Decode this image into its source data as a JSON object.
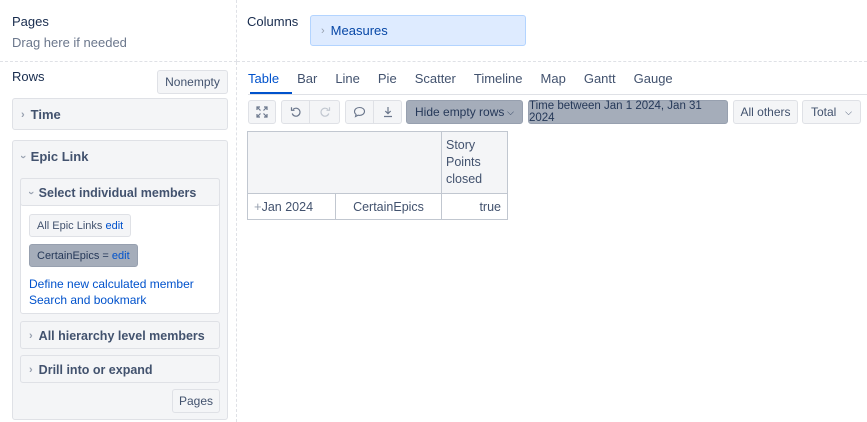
{
  "pages": {
    "title": "Pages",
    "hint": "Drag here if needed"
  },
  "columns": {
    "title": "Columns",
    "measures_label": "Measures"
  },
  "rows": {
    "title": "Rows",
    "nonempty_label": "Nonempty",
    "time_label": "Time",
    "epic_link_label": "Epic Link",
    "select_members_label": "Select individual members",
    "members": [
      {
        "label": "All Epic Links",
        "edit": "edit"
      },
      {
        "label": "CertainEpics =",
        "edit": "edit"
      }
    ],
    "define_calculated": "Define new calculated member",
    "search_bookmark": "Search and bookmark",
    "hierarchy_label": "All hierarchy level members",
    "drill_label": "Drill into or expand",
    "pages_button": "Pages"
  },
  "tabs": [
    "Table",
    "Bar",
    "Line",
    "Pie",
    "Scatter",
    "Timeline",
    "Map",
    "Gantt",
    "Gauge"
  ],
  "toolbar": {
    "hide_empty_rows": "Hide empty rows",
    "time_filter": "Time between Jan 1 2024, Jan 31 2024",
    "all_others": "All others",
    "total": "Total"
  },
  "table": {
    "measure_header": [
      "Story",
      "Points",
      "closed"
    ],
    "row": {
      "time": "Jan 2024",
      "epic": "CertainEpics",
      "value": "true"
    }
  },
  "icons": {
    "expand": "expand-icon",
    "undo": "undo-icon",
    "redo": "redo-icon",
    "comment": "comment-icon",
    "download": "download-icon"
  }
}
